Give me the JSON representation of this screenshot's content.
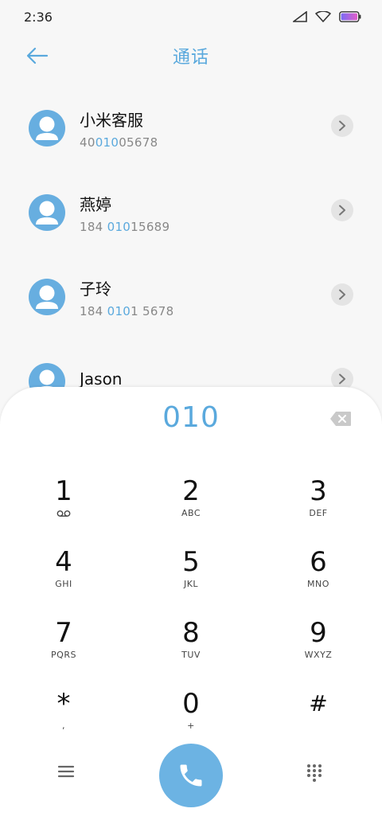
{
  "status": {
    "time": "2:36"
  },
  "header": {
    "title": "通话"
  },
  "contacts": [
    {
      "name": "小米客服",
      "number_pre": "40",
      "number_match": "010",
      "number_post": "05678"
    },
    {
      "name": "燕婷",
      "number_pre": "184 ",
      "number_match": "010",
      "number_post": "15689"
    },
    {
      "name": "子玲",
      "number_pre": "184 ",
      "number_match": "010",
      "number_post": "1 5678"
    },
    {
      "name": "Jason",
      "number_pre": "",
      "number_match": "",
      "number_post": ""
    }
  ],
  "dialer": {
    "input": "010",
    "keys": [
      {
        "digit": "1",
        "letters": ""
      },
      {
        "digit": "2",
        "letters": "ABC"
      },
      {
        "digit": "3",
        "letters": "DEF"
      },
      {
        "digit": "4",
        "letters": "GHI"
      },
      {
        "digit": "5",
        "letters": "JKL"
      },
      {
        "digit": "6",
        "letters": "MNO"
      },
      {
        "digit": "7",
        "letters": "PQRS"
      },
      {
        "digit": "8",
        "letters": "TUV"
      },
      {
        "digit": "9",
        "letters": "WXYZ"
      },
      {
        "digit": "*",
        "letters": ","
      },
      {
        "digit": "0",
        "letters": "+"
      },
      {
        "digit": "#",
        "letters": ""
      }
    ]
  },
  "icons": {
    "back": "back-arrow-icon",
    "info": "chevron-right-icon",
    "backspace": "backspace-icon",
    "voicemail": "voicemail-icon",
    "menu": "menu-icon",
    "call": "phone-icon",
    "keypad": "keypad-icon"
  },
  "colors": {
    "accent": "#5aa9dd",
    "avatar": "#67aee0",
    "call_button": "#6cb3e3"
  }
}
